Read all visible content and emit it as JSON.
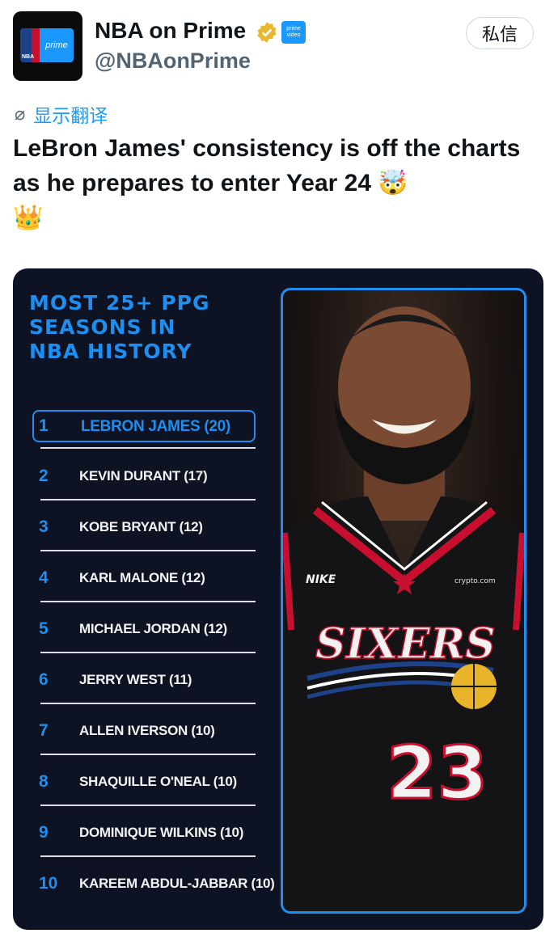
{
  "author": {
    "name": "NBA on Prime",
    "handle": "@NBAonPrime",
    "avatar_text": "prime",
    "avatar_logo": "NBA",
    "verified_icon": "verified-badge-icon",
    "prime_tag": "prime video"
  },
  "actions": {
    "message_label": "私信"
  },
  "translate": {
    "icon": "globe-icon",
    "label": "显示翻译"
  },
  "tweet": {
    "text": "LeBron James' consistency is off the charts as he prepares to enter Year 24",
    "emojis": [
      "🤯",
      "👑"
    ]
  },
  "card": {
    "title_lines": [
      "MOST 25+ PPG",
      "SEASONS IN",
      "NBA HISTORY"
    ],
    "accent_color": "#1e8ef0",
    "background_color": "#0d1322",
    "rankings": [
      {
        "rank": "1",
        "name": "LEBRON JAMES (20)"
      },
      {
        "rank": "2",
        "name": "KEVIN DURANT (17)"
      },
      {
        "rank": "3",
        "name": "KOBE BRYANT (12)"
      },
      {
        "rank": "4",
        "name": "KARL MALONE (12)"
      },
      {
        "rank": "5",
        "name": "MICHAEL JORDAN (12)"
      },
      {
        "rank": "6",
        "name": "JERRY WEST (11)"
      },
      {
        "rank": "7",
        "name": "ALLEN IVERSON (10)"
      },
      {
        "rank": "8",
        "name": "SHAQUILLE O'NEAL (10)"
      },
      {
        "rank": "9",
        "name": "DOMINIQUE WILKINS (10)"
      },
      {
        "rank": "10",
        "name": "KAREEM ABDUL-JABBAR (10)"
      }
    ],
    "photo": {
      "jersey_text": "SIXERS",
      "jersey_number": "23",
      "brand_text": "NIKE",
      "sponsor_text": "crypto.com"
    }
  }
}
